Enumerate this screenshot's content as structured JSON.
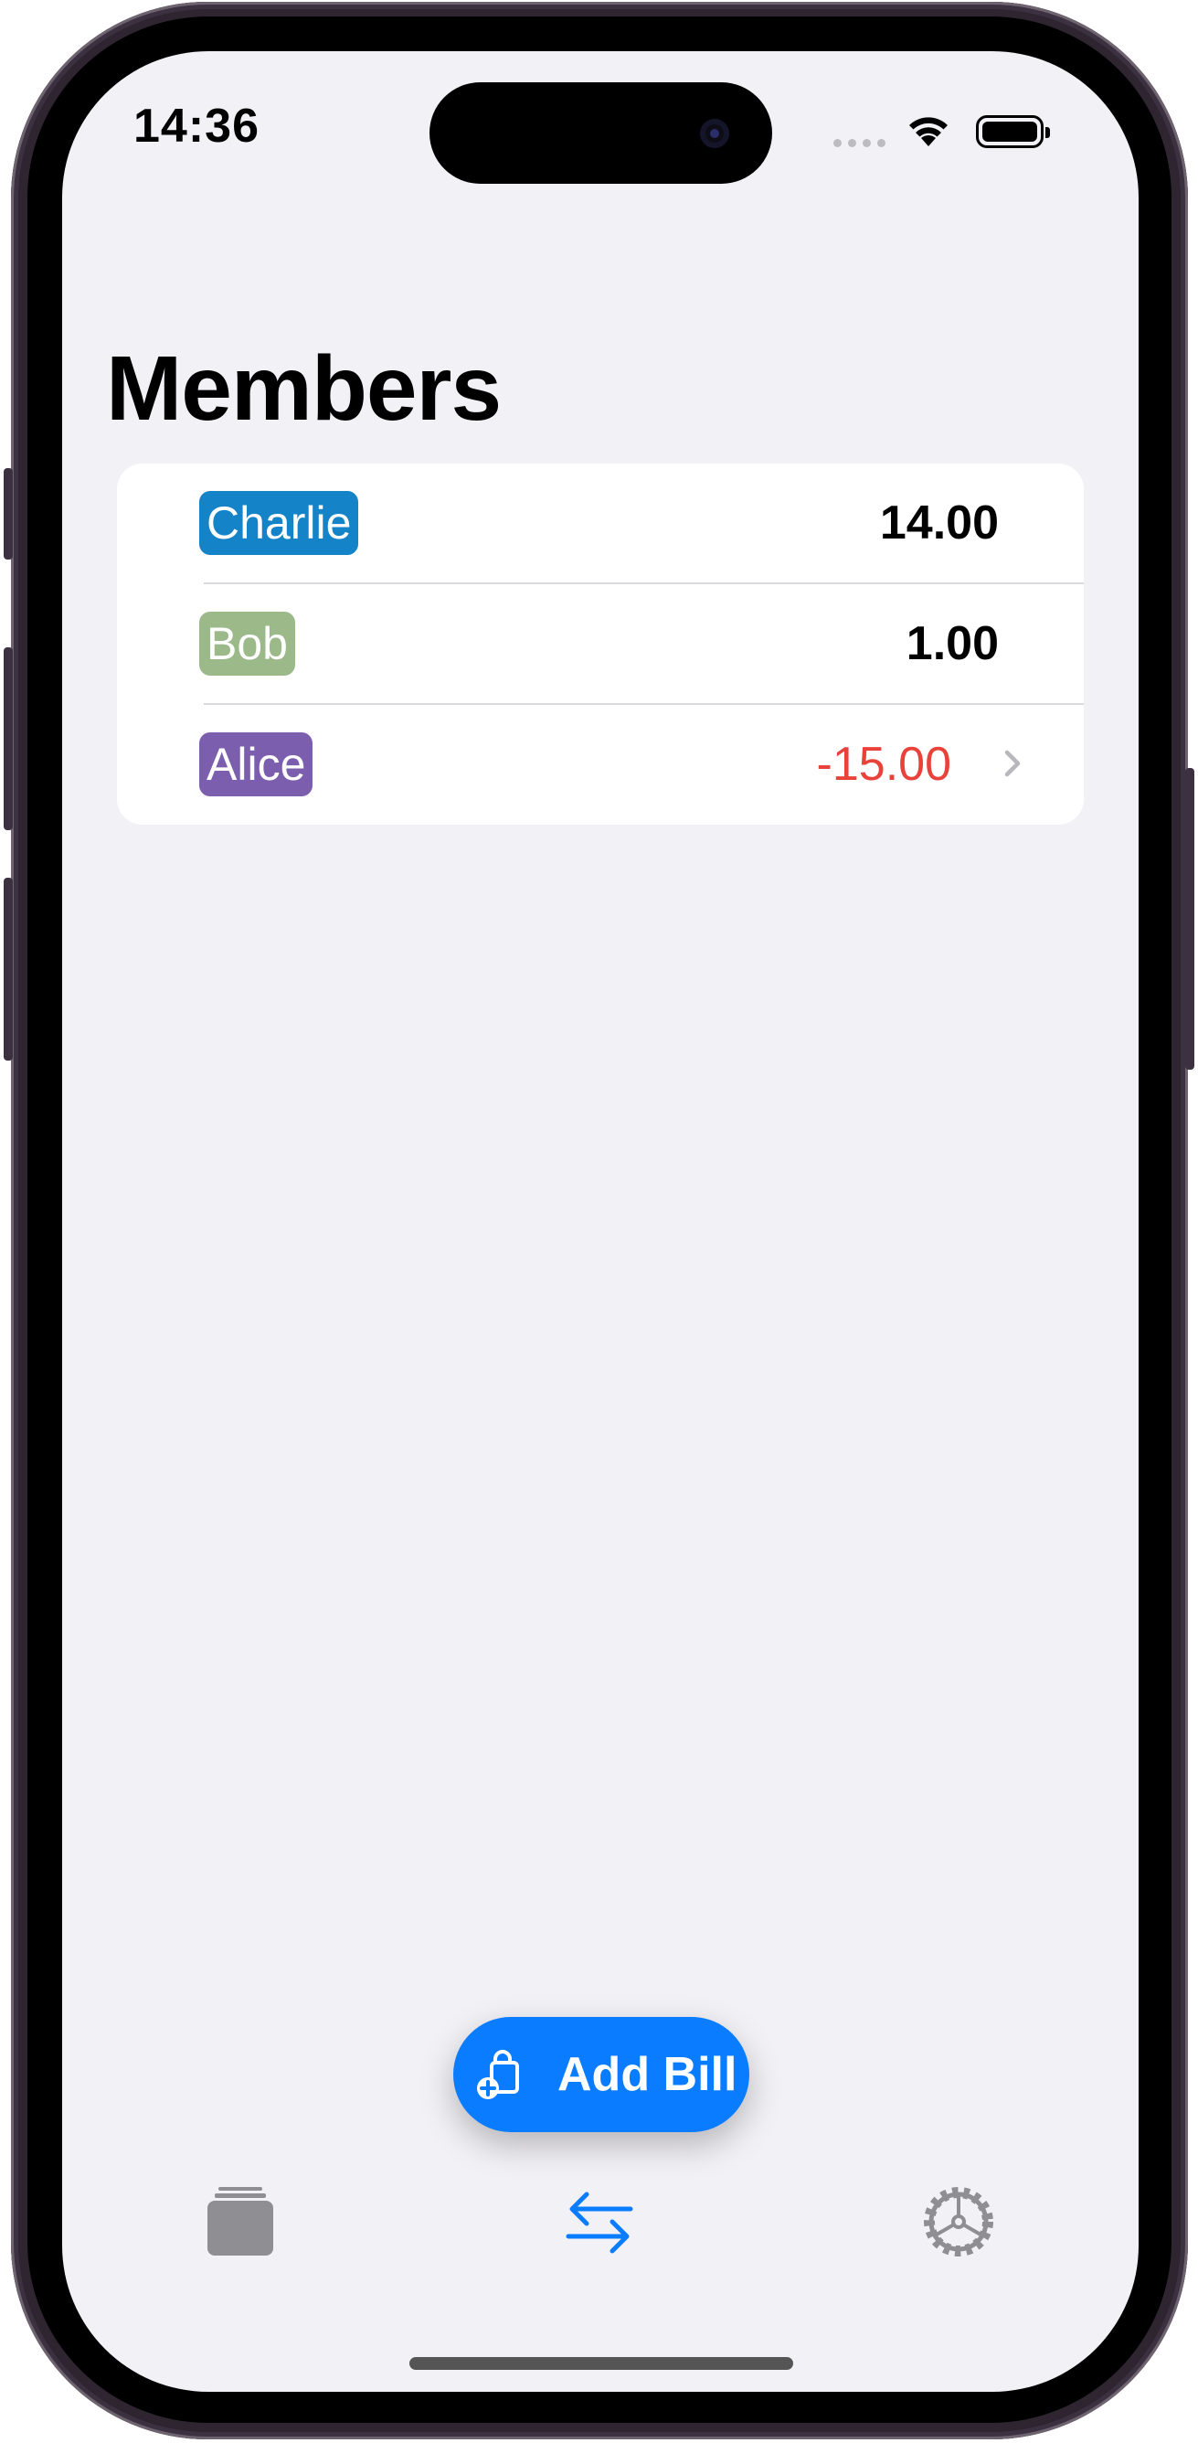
{
  "status_bar": {
    "time": "14:36"
  },
  "page": {
    "title": "Members"
  },
  "members": [
    {
      "name": "Charlie",
      "balance": "14.00",
      "color": "#1583c7"
    },
    {
      "name": "Bob",
      "balance": "1.00",
      "color": "#9cb98a"
    },
    {
      "name": "Alice",
      "balance": "-15.00",
      "color": "#7b5fae"
    }
  ],
  "add_bill": {
    "label": "Add Bill",
    "icon": "bag-plus-icon"
  },
  "tab_bar": {
    "tabs": [
      {
        "icon": "stack-icon",
        "selected": false
      },
      {
        "icon": "transfer-arrows-icon",
        "selected": true
      },
      {
        "icon": "gear-icon",
        "selected": false
      }
    ]
  },
  "colors": {
    "accent": "#0a7cff",
    "negative": "#e9423b",
    "background": "#f2f1f6"
  }
}
